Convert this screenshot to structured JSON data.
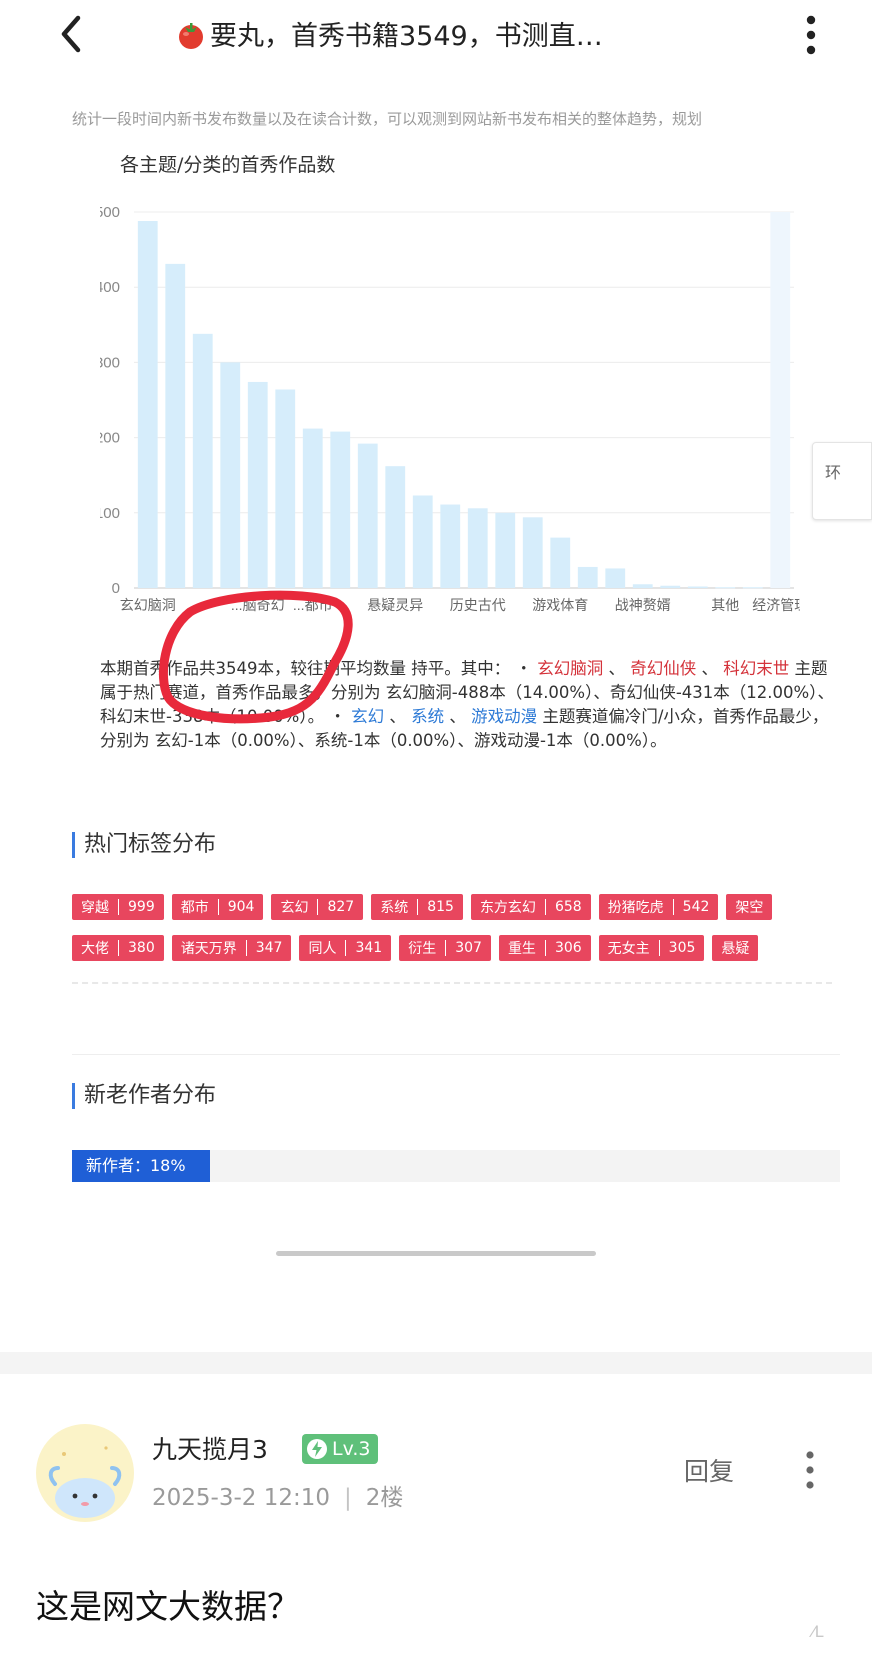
{
  "header": {
    "title": "要丸，首秀书籍3549，书测直…",
    "tomato_icon": "tomato-emoji",
    "back_icon": "chevron-left-icon",
    "more_icon": "vertical-dots-icon"
  },
  "intro_text": "统计一段时间内新书发布数量以及在读合计数，可以观测到网站新书发布相关的整体趋势，规划",
  "chart_data": {
    "type": "bar",
    "title": "各主题/分类的首秀作品数",
    "ylim": [
      0,
      500
    ],
    "yticks": [
      0,
      100,
      200,
      300,
      400,
      500
    ],
    "grid": true,
    "bar_color": "#d6edfb",
    "values": [
      488,
      431,
      338,
      300,
      274,
      264,
      212,
      208,
      192,
      162,
      123,
      111,
      106,
      100,
      94,
      67,
      28,
      26,
      5,
      3,
      2,
      1,
      1,
      500
    ],
    "category_labels": [
      {
        "index": 0,
        "label": "玄幻脑洞"
      },
      {
        "index": 4,
        "label": "...脑奇幻"
      },
      {
        "index": 6,
        "label": "...都市"
      },
      {
        "index": 9,
        "label": "悬疑灵异"
      },
      {
        "index": 12,
        "label": "历史古代"
      },
      {
        "index": 15,
        "label": "游戏体育"
      },
      {
        "index": 18,
        "label": "战神赘婿"
      },
      {
        "index": 21,
        "label": "其他"
      },
      {
        "index": 23,
        "label": "经济管理"
      }
    ]
  },
  "side_widget_text": "环",
  "summary": {
    "part1": "本期首秀作品共3549本，较往期平均数量 持平。其中：",
    "bullet": "・",
    "hot1": "玄幻脑洞",
    "hot2": "奇幻仙侠",
    "hot3": "科幻末世",
    "part2": "主题属于热门赛道，首秀作品最多，分别为 玄幻脑洞-488本（14.00%）、奇幻仙侠-431本（12.00%）、科幻末世-338本（10.00%）。",
    "cold1": "玄幻",
    "cold2": "系统",
    "cold3": "游戏动漫",
    "part3": "主题赛道偏冷门/小众，首秀作品最少，分别为 玄幻-1本（0.00%）、系统-1本（0.00%）、游戏动漫-1本（0.00%）。",
    "sep": "、"
  },
  "tags_section": {
    "title": "热门标签分布",
    "row1": [
      {
        "name": "穿越",
        "count": "999"
      },
      {
        "name": "都市",
        "count": "904"
      },
      {
        "name": "玄幻",
        "count": "827"
      },
      {
        "name": "系统",
        "count": "815"
      },
      {
        "name": "东方玄幻",
        "count": "658"
      },
      {
        "name": "扮猪吃虎",
        "count": "542"
      },
      {
        "name": "架空",
        "count": ""
      }
    ],
    "row2": [
      {
        "name": "大佬",
        "count": "380"
      },
      {
        "name": "诸天万界",
        "count": "347"
      },
      {
        "name": "同人",
        "count": "341"
      },
      {
        "name": "衍生",
        "count": "307"
      },
      {
        "name": "重生",
        "count": "306"
      },
      {
        "name": "无女主",
        "count": "305"
      },
      {
        "name": "悬疑",
        "count": ""
      }
    ]
  },
  "authors_section": {
    "title": "新老作者分布",
    "new_label": "新作者：18%",
    "new_fraction": 0.18
  },
  "post": {
    "username": "九天揽月3",
    "level": "Lv.3",
    "date": "2025-3-2 12:10",
    "separator": "|",
    "floor": "2楼",
    "reply_label": "回复",
    "comment": "这是网文大数据？"
  },
  "watermark": "⁄L"
}
